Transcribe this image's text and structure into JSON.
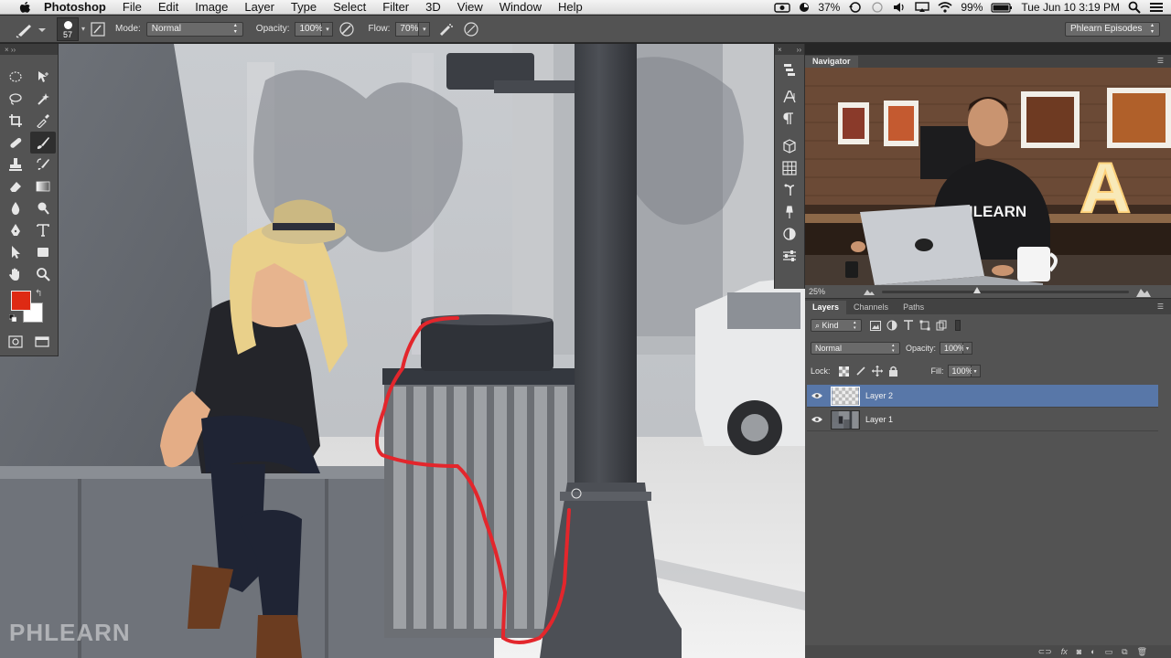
{
  "menubar": {
    "app_name": "Photoshop",
    "items": [
      "File",
      "Edit",
      "Image",
      "Layer",
      "Type",
      "Select",
      "Filter",
      "3D",
      "View",
      "Window",
      "Help"
    ],
    "battery_small": "37%",
    "battery_main": "99%",
    "datetime": "Tue Jun 10  3:19 PM",
    "icons": [
      "apple-icon",
      "facetime-camera-icon",
      "timer-icon",
      "time-machine-icon",
      "sync-icon",
      "volume-icon",
      "airplay-icon",
      "wifi-icon",
      "battery-icon",
      "search-icon",
      "notification-center-icon"
    ]
  },
  "options_bar": {
    "brush_size": "57",
    "mode_label": "Mode:",
    "mode_value": "Normal",
    "opacity_label": "Opacity:",
    "opacity_value": "100%",
    "flow_label": "Flow:",
    "flow_value": "70%",
    "workspace": "Phlearn Episodes"
  },
  "canvas": {
    "watermark": "PHLEARN"
  },
  "tools_panel": {
    "tools": [
      {
        "name": "marquee-tool",
        "icon": "marquee-icon"
      },
      {
        "name": "move-tool",
        "icon": "move-icon"
      },
      {
        "name": "lasso-tool",
        "icon": "lasso-icon"
      },
      {
        "name": "magic-wand-tool",
        "icon": "magic-wand-icon"
      },
      {
        "name": "crop-tool",
        "icon": "crop-icon"
      },
      {
        "name": "eyedropper-tool",
        "icon": "eyedropper-icon"
      },
      {
        "name": "healing-brush-tool",
        "icon": "bandage-icon"
      },
      {
        "name": "brush-tool",
        "icon": "brush-icon"
      },
      {
        "name": "clone-stamp-tool",
        "icon": "stamp-icon"
      },
      {
        "name": "history-brush-tool",
        "icon": "history-brush-icon"
      },
      {
        "name": "eraser-tool",
        "icon": "eraser-icon"
      },
      {
        "name": "gradient-tool",
        "icon": "gradient-icon"
      },
      {
        "name": "blur-tool",
        "icon": "drop-icon"
      },
      {
        "name": "dodge-tool",
        "icon": "dodge-icon"
      },
      {
        "name": "pen-tool",
        "icon": "pen-icon"
      },
      {
        "name": "type-tool",
        "icon": "type-icon"
      },
      {
        "name": "path-selection-tool",
        "icon": "arrow-icon"
      },
      {
        "name": "shape-tool",
        "icon": "rectangle-icon"
      },
      {
        "name": "hand-tool",
        "icon": "hand-icon"
      },
      {
        "name": "zoom-tool",
        "icon": "zoom-icon"
      }
    ],
    "foreground_color": "#de2a13",
    "background_color": "#ffffff"
  },
  "navigator": {
    "tab": "Navigator",
    "zoom": "25%",
    "video_shirt_text": "PHLEARN",
    "video_sign_letter": "A"
  },
  "layers_panel": {
    "tabs": [
      "Layers",
      "Channels",
      "Paths"
    ],
    "filter_kind": "Kind",
    "blend_mode": "Normal",
    "opacity_label": "Opacity:",
    "opacity_value": "100%",
    "lock_label": "Lock:",
    "fill_label": "Fill:",
    "fill_value": "100%",
    "layers": [
      {
        "name": "Layer 2",
        "selected": true
      },
      {
        "name": "Layer 1",
        "selected": false
      }
    ]
  },
  "colors": {
    "accent_selection": "#5877a8",
    "panel_bg": "#535353",
    "foreground": "#de2a13"
  }
}
